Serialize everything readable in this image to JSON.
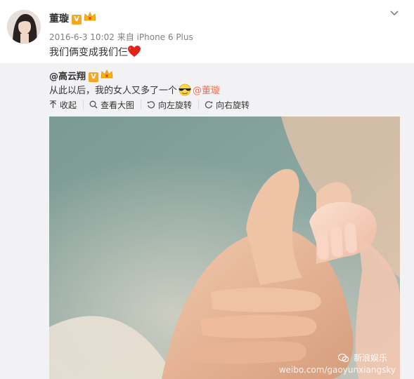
{
  "post": {
    "author": "董璇",
    "timestamp": "2016-6-3 10:02",
    "source_prefix": "来自",
    "source": "iPhone 6 Plus",
    "text": "我们俩变成我们仨",
    "icons": [
      "verified-v-icon",
      "member-crown-icon",
      "chevron-down-icon",
      "red-heart-icon"
    ]
  },
  "repost": {
    "author": "@高云翔",
    "text": "从此以后，我的女人又多了一个",
    "mention": "@董璇",
    "actions": [
      {
        "icon": "collapse-up-icon",
        "label": "收起"
      },
      {
        "icon": "magnifier-icon",
        "label": "查看大图"
      },
      {
        "icon": "rotate-left-icon",
        "label": "向左旋转"
      },
      {
        "icon": "rotate-right-icon",
        "label": "向右旋转"
      }
    ]
  },
  "watermark": {
    "url": "weibo.com/gaoyunxiangsky",
    "brand": "新浪娱乐"
  },
  "colors": {
    "accent": "#eb7350",
    "meta": "#808080",
    "repost_bg": "#f2f2f5",
    "verified": "#f5a623"
  }
}
